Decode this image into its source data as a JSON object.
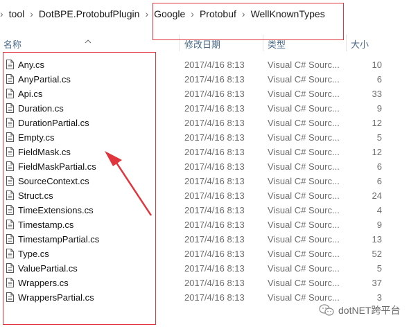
{
  "breadcrumb": {
    "items": [
      "tool",
      "DotBPE.ProtobufPlugin",
      "Google",
      "Protobuf",
      "WellKnownTypes"
    ],
    "separator": "›"
  },
  "columns": {
    "name": "名称",
    "modified": "修改日期",
    "type": "类型",
    "size": "大小"
  },
  "files": [
    {
      "name": "Any.cs",
      "modified": "2017/4/16 8:13",
      "type": "Visual C# Sourc...",
      "size": "10"
    },
    {
      "name": "AnyPartial.cs",
      "modified": "2017/4/16 8:13",
      "type": "Visual C# Sourc...",
      "size": "6"
    },
    {
      "name": "Api.cs",
      "modified": "2017/4/16 8:13",
      "type": "Visual C# Sourc...",
      "size": "33"
    },
    {
      "name": "Duration.cs",
      "modified": "2017/4/16 8:13",
      "type": "Visual C# Sourc...",
      "size": "9"
    },
    {
      "name": "DurationPartial.cs",
      "modified": "2017/4/16 8:13",
      "type": "Visual C# Sourc...",
      "size": "12"
    },
    {
      "name": "Empty.cs",
      "modified": "2017/4/16 8:13",
      "type": "Visual C# Sourc...",
      "size": "5"
    },
    {
      "name": "FieldMask.cs",
      "modified": "2017/4/16 8:13",
      "type": "Visual C# Sourc...",
      "size": "12"
    },
    {
      "name": "FieldMaskPartial.cs",
      "modified": "2017/4/16 8:13",
      "type": "Visual C# Sourc...",
      "size": "6"
    },
    {
      "name": "SourceContext.cs",
      "modified": "2017/4/16 8:13",
      "type": "Visual C# Sourc...",
      "size": "6"
    },
    {
      "name": "Struct.cs",
      "modified": "2017/4/16 8:13",
      "type": "Visual C# Sourc...",
      "size": "24"
    },
    {
      "name": "TimeExtensions.cs",
      "modified": "2017/4/16 8:13",
      "type": "Visual C# Sourc...",
      "size": "4"
    },
    {
      "name": "Timestamp.cs",
      "modified": "2017/4/16 8:13",
      "type": "Visual C# Sourc...",
      "size": "9"
    },
    {
      "name": "TimestampPartial.cs",
      "modified": "2017/4/16 8:13",
      "type": "Visual C# Sourc...",
      "size": "13"
    },
    {
      "name": "Type.cs",
      "modified": "2017/4/16 8:13",
      "type": "Visual C# Sourc...",
      "size": "52"
    },
    {
      "name": "ValuePartial.cs",
      "modified": "2017/4/16 8:13",
      "type": "Visual C# Sourc...",
      "size": "5"
    },
    {
      "name": "Wrappers.cs",
      "modified": "2017/4/16 8:13",
      "type": "Visual C# Sourc...",
      "size": "37"
    },
    {
      "name": "WrappersPartial.cs",
      "modified": "2017/4/16 8:13",
      "type": "Visual C# Sourc...",
      "size": "3"
    }
  ],
  "watermark": {
    "text": "dotNET跨平台"
  },
  "colors": {
    "annotation": "#e0353c",
    "header_text": "#4a6a8a",
    "meta_text": "#6d6d6d"
  },
  "icons": {
    "file": "document-icon",
    "sort": "sort-up-icon",
    "wechat": "wechat-icon"
  }
}
